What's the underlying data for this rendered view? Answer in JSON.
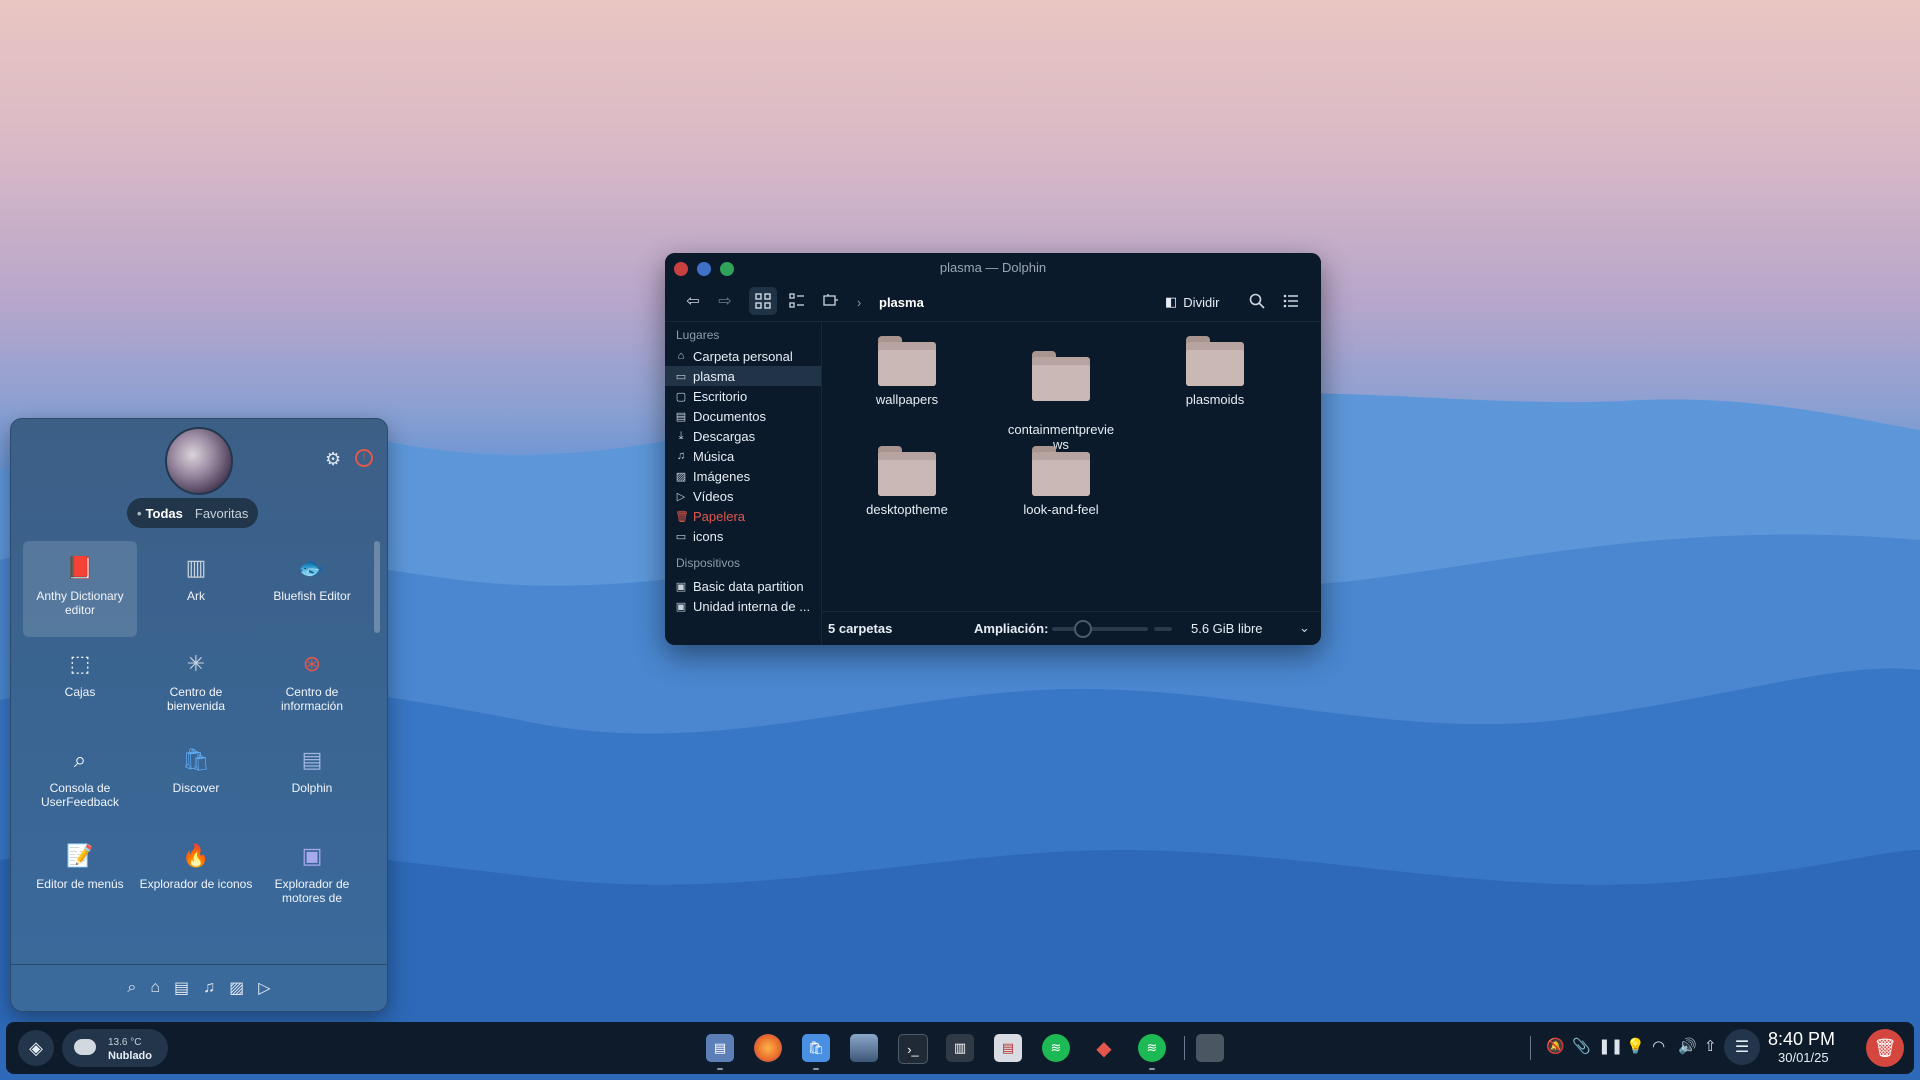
{
  "dolphin": {
    "title": "plasma — Dolphin",
    "breadcrumb": "plasma",
    "split_label": "Dividir",
    "places_header": "Lugares",
    "places": [
      {
        "label": "Carpeta personal",
        "icon": "home-icon"
      },
      {
        "label": "plasma",
        "icon": "folder-icon"
      },
      {
        "label": "Escritorio",
        "icon": "desktop-icon"
      },
      {
        "label": "Documentos",
        "icon": "document-icon"
      },
      {
        "label": "Descargas",
        "icon": "download-icon"
      },
      {
        "label": "Música",
        "icon": "music-icon"
      },
      {
        "label": "Imágenes",
        "icon": "image-icon"
      },
      {
        "label": "Vídeos",
        "icon": "video-icon"
      },
      {
        "label": "Papelera",
        "icon": "trash-icon"
      },
      {
        "label": "icons",
        "icon": "folder-icon"
      }
    ],
    "devices_header": "Dispositivos",
    "devices": [
      {
        "label": "Basic data partition",
        "icon": "drive-icon"
      },
      {
        "label": "Unidad interna de ...",
        "icon": "drive-icon"
      }
    ],
    "files": [
      "wallpapers",
      "containmentprevie\nws",
      "plasmoids",
      "desktoptheme",
      "look-and-feel"
    ],
    "status_count": "5 carpetas",
    "zoom_label": "Ampliación:",
    "free_space": "5.6 GiB libre"
  },
  "launcher": {
    "tab_all": "Todas",
    "tab_favorites": "Favoritas",
    "apps": [
      {
        "name": "Anthy Dictionary editor",
        "icon": "book-icon"
      },
      {
        "name": "Ark",
        "icon": "archive-icon"
      },
      {
        "name": "Bluefish Editor",
        "icon": "fish-icon"
      },
      {
        "name": "Cajas",
        "icon": "boxes-icon"
      },
      {
        "name": "Centro de bienvenida",
        "icon": "welcome-icon"
      },
      {
        "name": "Centro de información",
        "icon": "lifebuoy-icon"
      },
      {
        "name": "Consola de UserFeedback",
        "icon": "magnifier-icon"
      },
      {
        "name": "Discover",
        "icon": "store-icon"
      },
      {
        "name": "Dolphin",
        "icon": "file-manager-icon"
      },
      {
        "name": "Editor de menús",
        "icon": "menu-editor-icon"
      },
      {
        "name": "Explorador de iconos",
        "icon": "icon-explorer-icon"
      },
      {
        "name": "Explorador de motores de",
        "icon": "engine-explorer-icon"
      }
    ]
  },
  "taskbar": {
    "weather_temp": "13.6 °C",
    "weather_condition": "Nublado",
    "time": "8:40 PM",
    "date": "30/01/25"
  },
  "colors": {
    "accent": "#3e71c7",
    "close": "#c8403f",
    "maximize": "#2fa35a",
    "trash": "#d4473f"
  }
}
